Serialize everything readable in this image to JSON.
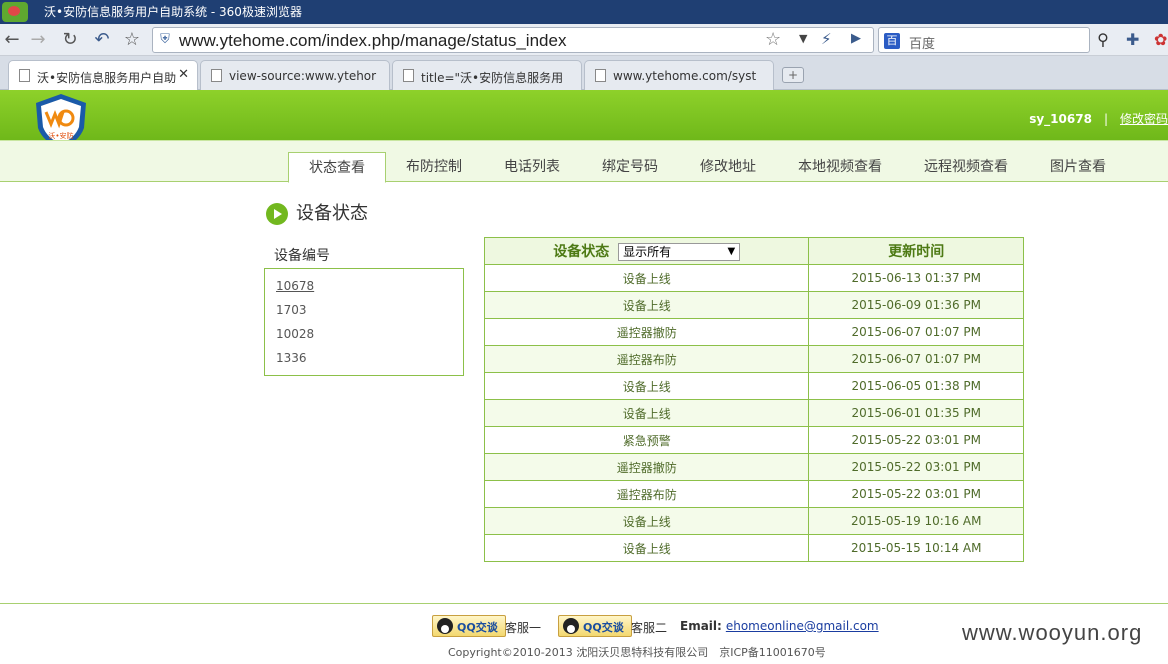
{
  "browser": {
    "window_title": "沃•安防信息服务用户自助系统 - 360极速浏览器",
    "url": "www.ytehome.com/index.php/manage/status_index",
    "search_placeholder": "百度",
    "search_engine_glyph": "百",
    "tabs": [
      {
        "label": "沃•安防信息服务用户自助"
      },
      {
        "label": "view-source:www.ytehor"
      },
      {
        "label": "title=\"沃•安防信息服务用"
      },
      {
        "label": "www.ytehome.com/syst"
      }
    ]
  },
  "header": {
    "username": "sy_10678",
    "separator": "|",
    "change_password": "修改密码",
    "logo_text": "沃•安防"
  },
  "nav": {
    "items": [
      "状态查看",
      "布防控制",
      "电话列表",
      "绑定号码",
      "修改地址",
      "本地视频查看",
      "远程视频查看",
      "图片查看"
    ]
  },
  "section": {
    "title": "设备状态"
  },
  "devices": {
    "label": "设备编号",
    "items": [
      "10678",
      "1703",
      "10028",
      "1336"
    ]
  },
  "status_table": {
    "status_header": "设备状态",
    "filter_value": "显示所有",
    "time_header": "更新时间",
    "rows": [
      {
        "status": "设备上线",
        "time": "2015-06-13 01:37 PM"
      },
      {
        "status": "设备上线",
        "time": "2015-06-09 01:36 PM"
      },
      {
        "status": "遥控器撤防",
        "time": "2015-06-07 01:07 PM"
      },
      {
        "status": "遥控器布防",
        "time": "2015-06-07 01:07 PM"
      },
      {
        "status": "设备上线",
        "time": "2015-06-05 01:38 PM"
      },
      {
        "status": "设备上线",
        "time": "2015-06-01 01:35 PM"
      },
      {
        "status": "紧急预警",
        "time": "2015-05-22 03:01 PM"
      },
      {
        "status": "遥控器撤防",
        "time": "2015-05-22 03:01 PM"
      },
      {
        "status": "遥控器布防",
        "time": "2015-05-22 03:01 PM"
      },
      {
        "status": "设备上线",
        "time": "2015-05-19 10:16 AM"
      },
      {
        "status": "设备上线",
        "time": "2015-05-15 10:14 AM"
      }
    ]
  },
  "footer": {
    "qq_button": "QQ交谈",
    "service1": "客服一",
    "service2": "客服二",
    "email_label": "Email:",
    "email": "ehomeonline@gmail.com",
    "copyright": "Copyright©2010-2013 沈阳沃贝思特科技有限公司　京ICP备11001670号"
  },
  "watermark": "www.wooyun.org",
  "colors": {
    "brand_green": "#7cc11f",
    "table_border": "#8cc049"
  }
}
